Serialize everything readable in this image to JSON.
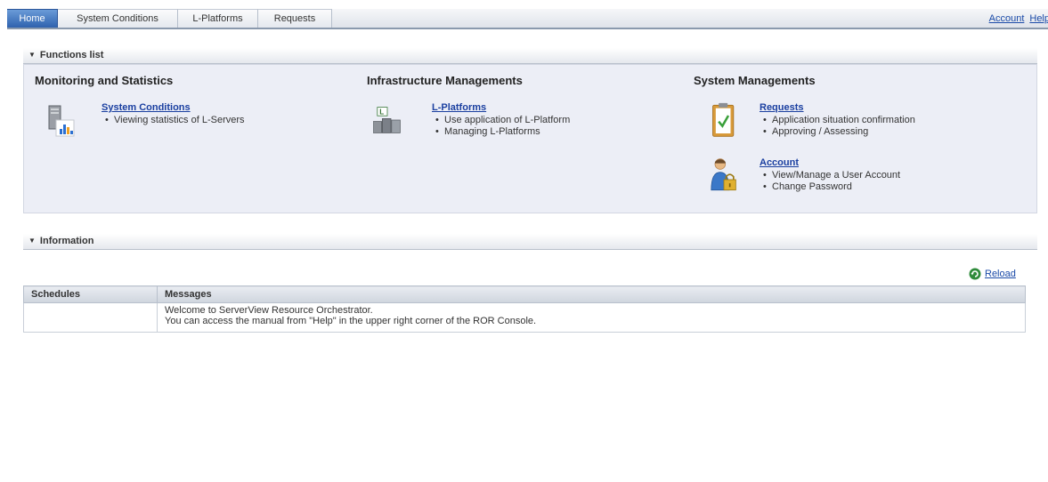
{
  "nav": {
    "tabs": [
      {
        "label": "Home",
        "active": true
      },
      {
        "label": "System Conditions",
        "active": false
      },
      {
        "label": "L-Platforms",
        "active": false
      },
      {
        "label": "Requests",
        "active": false
      }
    ],
    "account_link": "Account",
    "help_link": "Help"
  },
  "functions": {
    "header": "Functions list",
    "monitoring": {
      "title": "Monitoring and Statistics",
      "items": [
        {
          "link": "System Conditions",
          "icon": "server-chart-icon",
          "bullets": [
            "Viewing statistics of L-Servers"
          ]
        }
      ]
    },
    "infrastructure": {
      "title": "Infrastructure Managements",
      "items": [
        {
          "link": "L-Platforms",
          "icon": "l-platform-icon",
          "bullets": [
            "Use application of L-Platform",
            "Managing L-Platforms"
          ]
        }
      ]
    },
    "system": {
      "title": "System Managements",
      "items": [
        {
          "link": "Requests",
          "icon": "clipboard-check-icon",
          "bullets": [
            "Application situation confirmation",
            "Approving / Assessing"
          ]
        },
        {
          "link": "Account",
          "icon": "user-lock-icon",
          "bullets": [
            "View/Manage a User Account",
            "Change Password"
          ]
        }
      ]
    }
  },
  "information": {
    "header": "Information",
    "reload_label": "Reload",
    "columns": [
      "Schedules",
      "Messages"
    ],
    "rows": [
      {
        "schedule": "",
        "messages": [
          "Welcome to ServerView Resource Orchestrator.",
          "You can access the manual from \"Help\" in the upper right corner of the ROR Console."
        ]
      }
    ]
  },
  "colors": {
    "active_tab": "#3a6fbd",
    "link": "#1a3fa0",
    "panel_bg": "#eceef6"
  }
}
